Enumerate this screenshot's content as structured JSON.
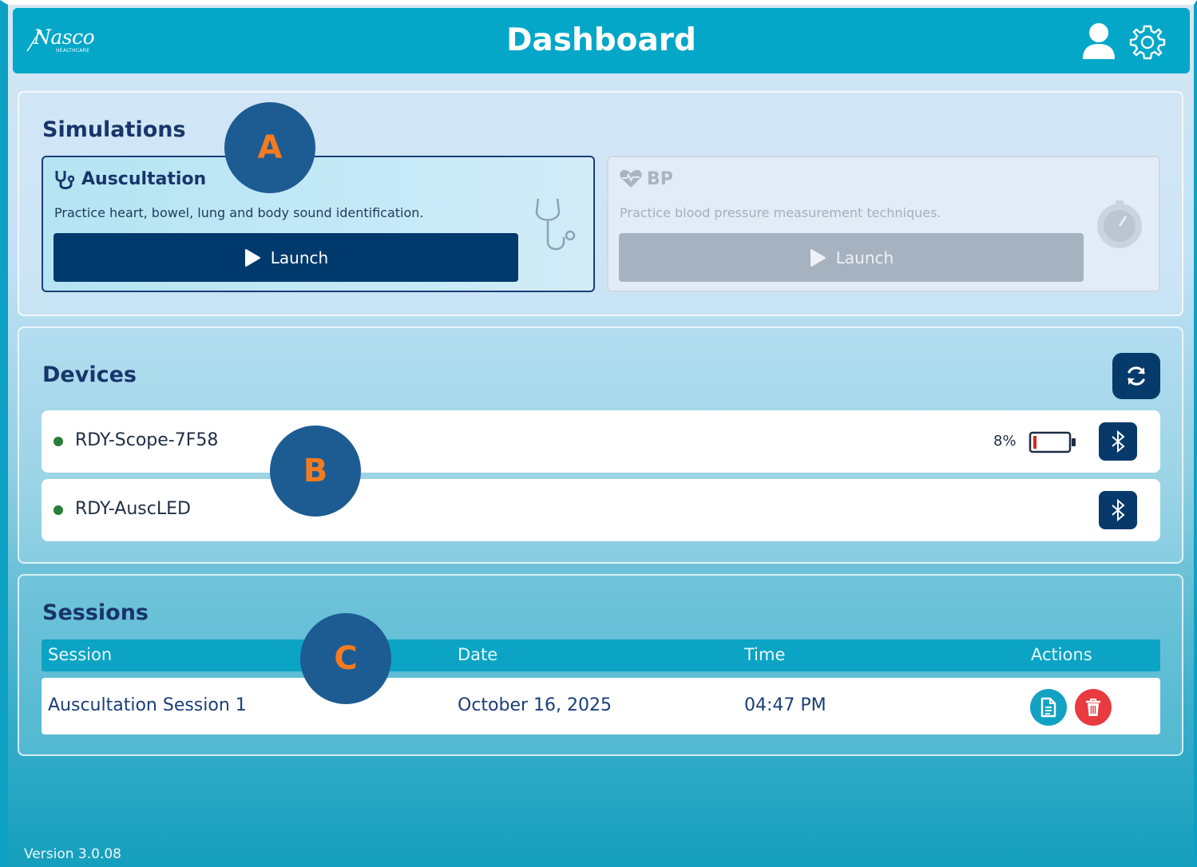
{
  "header": {
    "title": "Dashboard",
    "logo_text": "Nasco",
    "logo_sub": "HEALTHCARE"
  },
  "simulations": {
    "title": "Simulations",
    "cards": [
      {
        "title": "Auscultation",
        "description": "Practice heart, bowel, lung and body sound identification.",
        "launch_label": "Launch",
        "state": "enabled"
      },
      {
        "title": "BP",
        "description": "Practice blood pressure measurement techniques.",
        "launch_label": "Launch",
        "state": "disabled"
      }
    ]
  },
  "devices": {
    "title": "Devices",
    "items": [
      {
        "name": "RDY-Scope-7F58",
        "status": "connected",
        "battery": "8%"
      },
      {
        "name": "RDY-AuscLED",
        "status": "connected",
        "battery": ""
      }
    ]
  },
  "sessions": {
    "title": "Sessions",
    "columns": [
      "Session",
      "Date",
      "Time",
      "Actions"
    ],
    "rows": [
      {
        "session": "Auscultation Session 1",
        "date": "October 16, 2025",
        "time": "04:47 PM"
      }
    ]
  },
  "markers": [
    "A",
    "B",
    "C"
  ],
  "footer": {
    "version": "Version 3.0.08"
  },
  "colors": {
    "header": "#04a7c8",
    "primary_dark": "#003a6c",
    "marker_bg": "#1d5c93",
    "marker_text": "#f47b20",
    "status_connected": "#2a7d3a",
    "delete_red": "#e83a3f",
    "report_teal": "#13a2c2"
  },
  "icons": [
    "stethoscope-icon",
    "heart-pulse-icon",
    "user-icon",
    "gear-icon",
    "refresh-icon",
    "bluetooth-icon",
    "battery-low-icon",
    "document-icon",
    "trash-icon",
    "play-icon",
    "gauge-icon"
  ]
}
